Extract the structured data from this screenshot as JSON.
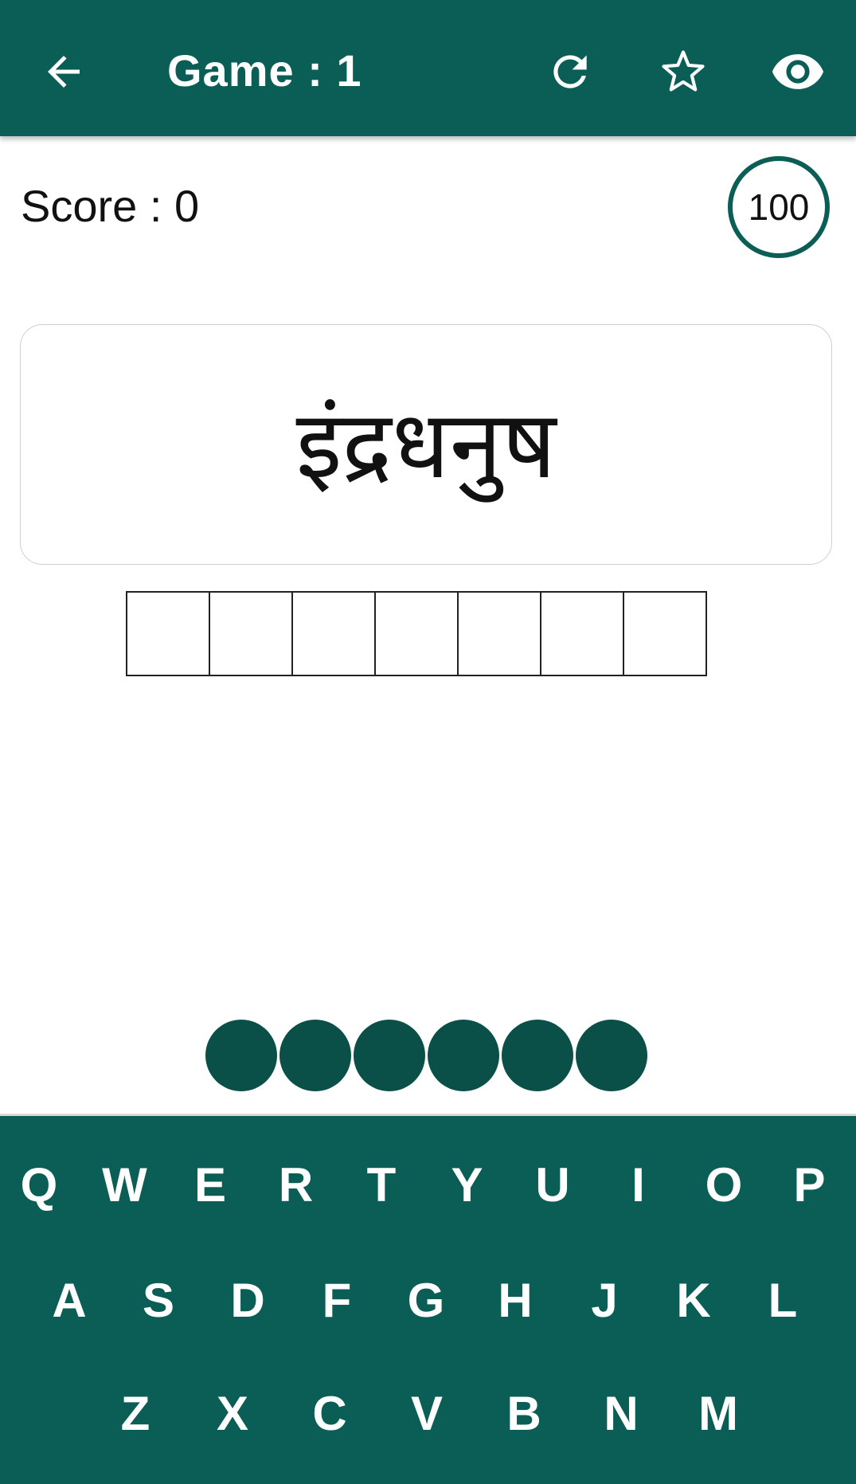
{
  "appbar": {
    "title": "Game : 1",
    "back_icon": "arrow-left-icon",
    "refresh_icon": "refresh-icon",
    "favorite_icon": "star-outline-icon",
    "reveal_icon": "eye-icon",
    "background": "#0b5e55"
  },
  "score": {
    "label": "Score : 0"
  },
  "timer": {
    "value": "100"
  },
  "word": {
    "text": "इंद्रधनुष"
  },
  "answer": {
    "slots": 7,
    "filled": [
      "",
      "",
      "",
      "",
      "",
      "",
      ""
    ]
  },
  "dots": {
    "count": 6,
    "color": "#0b5048"
  },
  "keyboard": {
    "background": "#0b5e55",
    "rows": [
      [
        "Q",
        "W",
        "E",
        "R",
        "T",
        "Y",
        "U",
        "I",
        "O",
        "P"
      ],
      [
        "A",
        "S",
        "D",
        "F",
        "G",
        "H",
        "J",
        "K",
        "L"
      ],
      [
        "Z",
        "X",
        "C",
        "V",
        "B",
        "N",
        "M"
      ]
    ]
  }
}
